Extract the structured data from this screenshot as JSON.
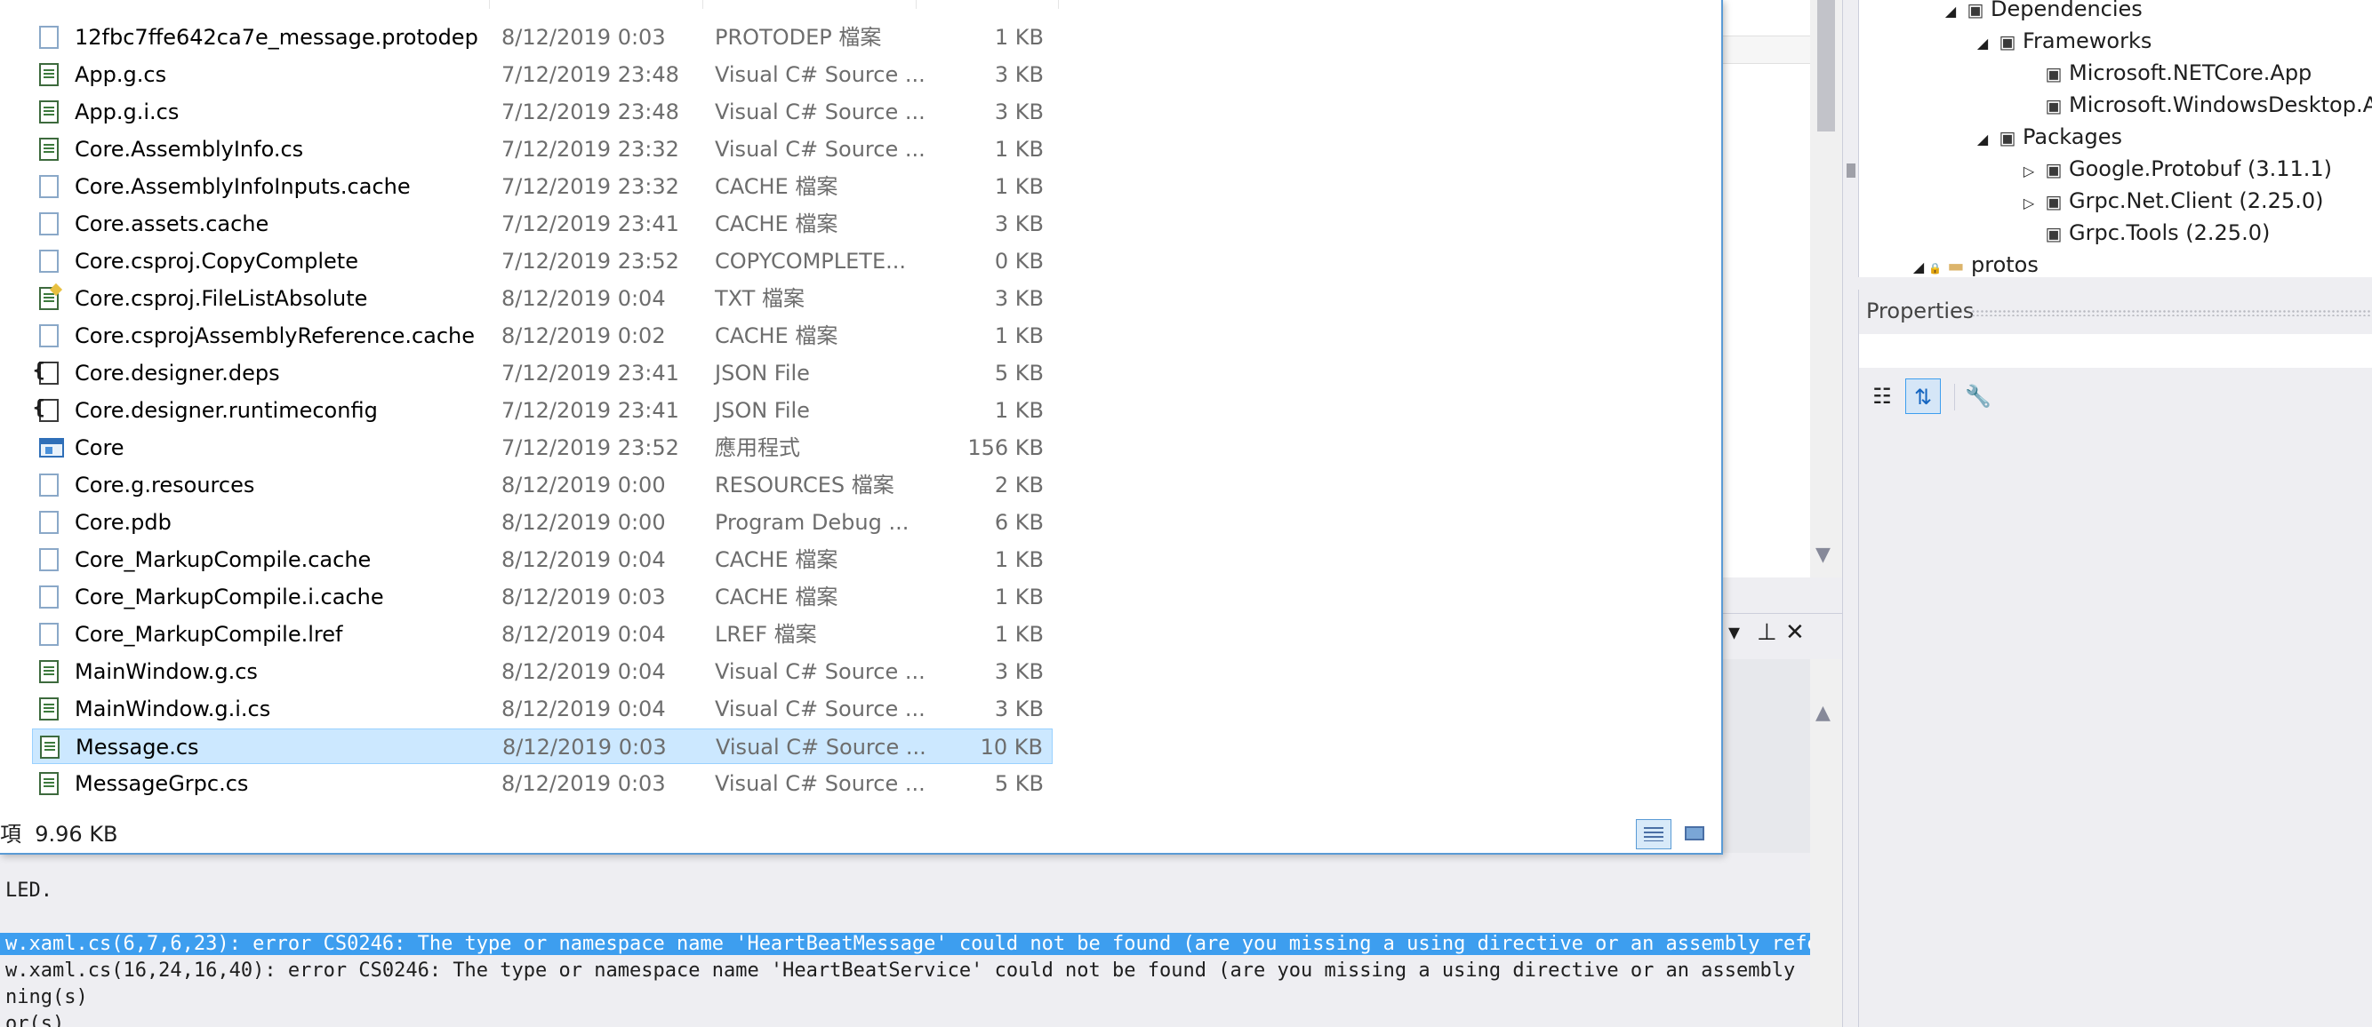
{
  "explorer": {
    "files": [
      {
        "name": "12fbc7ffe642ca7e_message.protodep",
        "date": "8/12/2019 0:03",
        "type": "PROTODEP 檔案",
        "size": "1 KB",
        "icon": "generic-file-icon"
      },
      {
        "name": "App.g.cs",
        "date": "7/12/2019 23:48",
        "type": "Visual C# Source ...",
        "size": "3 KB",
        "icon": "csharp-file-icon"
      },
      {
        "name": "App.g.i.cs",
        "date": "7/12/2019 23:48",
        "type": "Visual C# Source ...",
        "size": "3 KB",
        "icon": "csharp-file-icon"
      },
      {
        "name": "Core.AssemblyInfo.cs",
        "date": "7/12/2019 23:32",
        "type": "Visual C# Source ...",
        "size": "1 KB",
        "icon": "csharp-file-icon"
      },
      {
        "name": "Core.AssemblyInfoInputs.cache",
        "date": "7/12/2019 23:32",
        "type": "CACHE 檔案",
        "size": "1 KB",
        "icon": "generic-file-icon"
      },
      {
        "name": "Core.assets.cache",
        "date": "7/12/2019 23:41",
        "type": "CACHE 檔案",
        "size": "3 KB",
        "icon": "generic-file-icon"
      },
      {
        "name": "Core.csproj.CopyComplete",
        "date": "7/12/2019 23:52",
        "type": "COPYCOMPLETE...",
        "size": "0 KB",
        "icon": "generic-file-icon"
      },
      {
        "name": "Core.csproj.FileListAbsolute",
        "date": "8/12/2019 0:04",
        "type": "TXT 檔案",
        "size": "3 KB",
        "icon": "text-file-icon"
      },
      {
        "name": "Core.csprojAssemblyReference.cache",
        "date": "8/12/2019 0:02",
        "type": "CACHE 檔案",
        "size": "1 KB",
        "icon": "generic-file-icon"
      },
      {
        "name": "Core.designer.deps",
        "date": "7/12/2019 23:41",
        "type": "JSON File",
        "size": "5 KB",
        "icon": "json-file-icon"
      },
      {
        "name": "Core.designer.runtimeconfig",
        "date": "7/12/2019 23:41",
        "type": "JSON File",
        "size": "1 KB",
        "icon": "json-file-icon"
      },
      {
        "name": "Core",
        "date": "7/12/2019 23:52",
        "type": "應用程式",
        "size": "156 KB",
        "icon": "application-icon"
      },
      {
        "name": "Core.g.resources",
        "date": "8/12/2019 0:00",
        "type": "RESOURCES 檔案",
        "size": "2 KB",
        "icon": "generic-file-icon"
      },
      {
        "name": "Core.pdb",
        "date": "8/12/2019 0:00",
        "type": "Program Debug ...",
        "size": "6 KB",
        "icon": "generic-file-icon"
      },
      {
        "name": "Core_MarkupCompile.cache",
        "date": "8/12/2019 0:04",
        "type": "CACHE 檔案",
        "size": "1 KB",
        "icon": "generic-file-icon"
      },
      {
        "name": "Core_MarkupCompile.i.cache",
        "date": "8/12/2019 0:03",
        "type": "CACHE 檔案",
        "size": "1 KB",
        "icon": "generic-file-icon"
      },
      {
        "name": "Core_MarkupCompile.lref",
        "date": "8/12/2019 0:04",
        "type": "LREF 檔案",
        "size": "1 KB",
        "icon": "generic-file-icon"
      },
      {
        "name": "MainWindow.g.cs",
        "date": "8/12/2019 0:04",
        "type": "Visual C# Source ...",
        "size": "3 KB",
        "icon": "csharp-file-icon"
      },
      {
        "name": "MainWindow.g.i.cs",
        "date": "8/12/2019 0:04",
        "type": "Visual C# Source ...",
        "size": "3 KB",
        "icon": "csharp-file-icon"
      },
      {
        "name": "Message.cs",
        "date": "8/12/2019 0:03",
        "type": "Visual C# Source ...",
        "size": "10 KB",
        "icon": "csharp-file-icon",
        "selected": true
      },
      {
        "name": "MessageGrpc.cs",
        "date": "8/12/2019 0:03",
        "type": "Visual C# Source ...",
        "size": "5 KB",
        "icon": "csharp-file-icon"
      }
    ],
    "status": {
      "text": "項  9.96 KB"
    },
    "view_buttons": {
      "details_icon": "details-view-icon",
      "large_icon": "large-icons-view-icon"
    }
  },
  "solution_tree": {
    "items": [
      {
        "label": "Dependencies",
        "expander": "◢",
        "icon": "dependencies-icon",
        "glyph": "▣"
      },
      {
        "label": "Frameworks",
        "expander": "◢",
        "icon": "frameworks-icon",
        "glyph": "▣"
      },
      {
        "label": "Microsoft.NETCore.App",
        "expander": "",
        "icon": "framework-reference-icon",
        "glyph": "▣"
      },
      {
        "label": "Microsoft.WindowsDesktop.App",
        "expander": "",
        "icon": "framework-reference-icon",
        "glyph": "▣"
      },
      {
        "label": "Packages",
        "expander": "◢",
        "icon": "packages-icon",
        "glyph": "▣"
      },
      {
        "label": "Google.Protobuf (3.11.1)",
        "expander": "▷",
        "icon": "package-icon",
        "glyph": "▣"
      },
      {
        "label": "Grpc.Net.Client (2.25.0)",
        "expander": "▷",
        "icon": "package-icon",
        "glyph": "▣"
      },
      {
        "label": "Grpc.Tools (2.25.0)",
        "expander": "",
        "icon": "package-icon",
        "glyph": "▣"
      },
      {
        "label": "protos",
        "expander": "◢",
        "icon": "folder-icon",
        "glyph": "▬"
      }
    ]
  },
  "properties": {
    "title": "Properties",
    "toolbar": [
      {
        "name": "categorized-icon",
        "glyph": "☷"
      },
      {
        "name": "alphabetical-sort-icon",
        "glyph": "⇅"
      },
      {
        "name": "property-pages-icon",
        "glyph": "🔧"
      }
    ]
  },
  "mid_panel": {
    "dropdown_glyph": "▾",
    "pin_glyph": "⊥",
    "close_glyph": "✕",
    "scroll_down": "▼",
    "scroll_up": "▲"
  },
  "output": {
    "lines": [
      {
        "text": "LED.",
        "selected": false
      },
      {
        "text": "",
        "selected": false
      },
      {
        "text": "w.xaml.cs(6,7,6,23): error CS0246: The type or namespace name 'HeartBeatMessage' could not be found (are you missing a using directive or an assembly reference?)",
        "selected": true
      },
      {
        "text": "w.xaml.cs(16,24,16,40): error CS0246: The type or namespace name 'HeartBeatService' could not be found (are you missing a using directive or an assembly reference?)",
        "selected": false
      },
      {
        "text": "ning(s)",
        "selected": false
      },
      {
        "text": "or(s)",
        "selected": false
      }
    ]
  }
}
